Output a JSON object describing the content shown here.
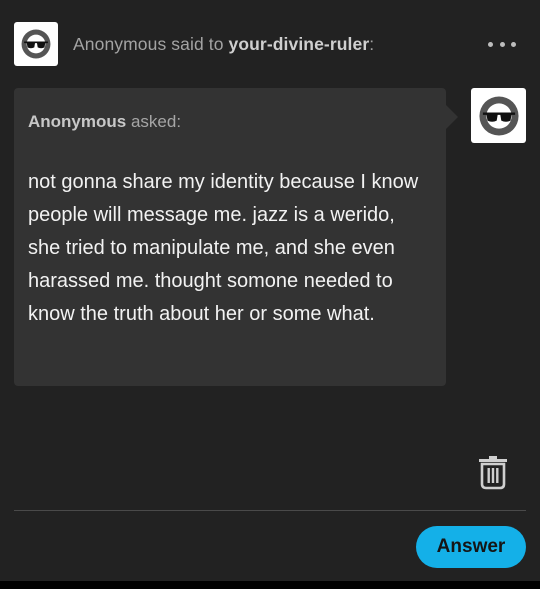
{
  "header": {
    "sender": "Anonymous",
    "said_to": " said to ",
    "recipient": "your-divine-ruler",
    "suffix": ":",
    "avatar_icon": "anonymous-sunglasses-icon",
    "menu_icon": "more-options-icon"
  },
  "question": {
    "asker": "Anonymous",
    "asked_label": " asked:",
    "body": "not gonna share my identity because I know people will message me. jazz is a werido, she tried to manipulate me, and she even harassed me. thought somone needed to know the truth about her or some what."
  },
  "recipient_avatar_icon": "anonymous-sunglasses-icon",
  "actions": {
    "delete_icon": "trash-icon",
    "answer_label": "Answer"
  },
  "colors": {
    "background": "#222222",
    "bubble": "#333333",
    "accent": "#14b0e8"
  }
}
